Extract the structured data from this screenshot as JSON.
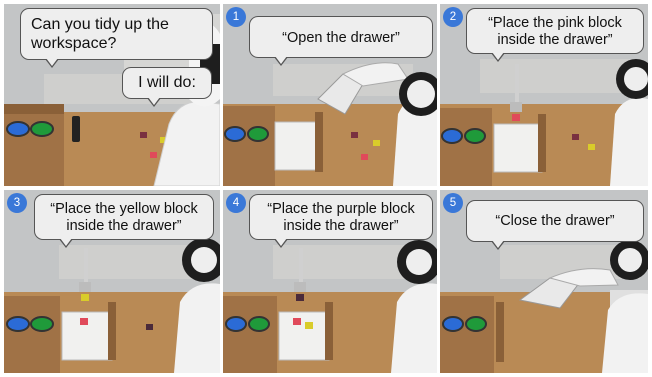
{
  "panels": [
    {
      "badge": "",
      "instruction": "Can you tidy up the workspace?",
      "reply": "I will do:"
    },
    {
      "badge": "1",
      "instruction": "“Open the drawer”"
    },
    {
      "badge": "2",
      "instruction": "“Place the pink block inside the drawer”"
    },
    {
      "badge": "3",
      "instruction": "“Place the yellow block inside the drawer”"
    },
    {
      "badge": "4",
      "instruction": "“Place the purple block inside the drawer”"
    },
    {
      "badge": "5",
      "instruction": "“Close the drawer”"
    }
  ],
  "colors": {
    "badge": "#3a78d8",
    "bubble_fill": "#eeeeee",
    "cork_counter": "#b98a55",
    "wall": "#b9bbbd",
    "robot_white": "#f2f2f2",
    "robot_black": "#1e1e1e",
    "button_blue": "#2b6bd6",
    "button_green": "#1f9a3a",
    "block_pink": "#e04a5a",
    "block_yellow": "#d9cc2a",
    "block_purple": "#4a2a3a"
  },
  "icons": [
    "step-number-badge",
    "speech-bubble"
  ]
}
